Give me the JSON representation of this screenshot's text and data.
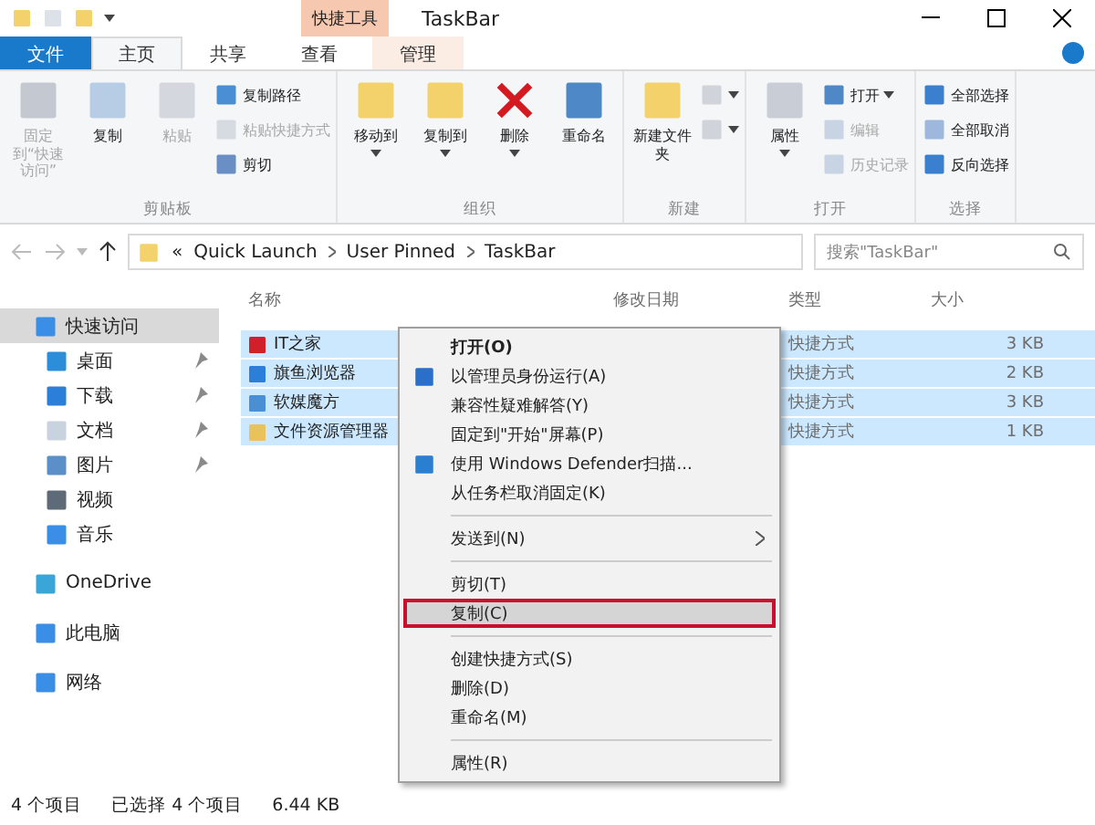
{
  "window": {
    "title": "TaskBar",
    "context_tab_group": "快捷工具"
  },
  "tabs": [
    {
      "label": "文件",
      "kind": "file",
      "selected": false
    },
    {
      "label": "主页",
      "kind": "tab",
      "selected": true
    },
    {
      "label": "共享",
      "kind": "tab",
      "selected": false
    },
    {
      "label": "查看",
      "kind": "tab",
      "selected": false
    },
    {
      "label": "管理",
      "kind": "context",
      "selected": false
    }
  ],
  "ribbon": {
    "groups": [
      {
        "label": "剪贴板",
        "items": [
          {
            "kind": "large",
            "label": "固定到“快速访问”",
            "disabled": true
          },
          {
            "kind": "large",
            "label": "复制",
            "disabled": false
          },
          {
            "kind": "large",
            "label": "粘贴",
            "disabled": true
          },
          {
            "kind": "stack",
            "items": [
              {
                "label": "复制路径",
                "disabled": false
              },
              {
                "label": "粘贴快捷方式",
                "disabled": true
              },
              {
                "label": "剪切",
                "disabled": false
              }
            ]
          }
        ]
      },
      {
        "label": "组织",
        "items": [
          {
            "kind": "large",
            "label": "移动到",
            "dropdown": true,
            "disabled": false
          },
          {
            "kind": "large",
            "label": "复制到",
            "dropdown": true,
            "disabled": false
          },
          {
            "kind": "large",
            "label": "删除",
            "dropdown": true,
            "disabled": false
          },
          {
            "kind": "large",
            "label": "重命名",
            "dropdown": false,
            "disabled": false
          }
        ]
      },
      {
        "label": "新建",
        "items": [
          {
            "kind": "large",
            "label": "新建文件夹",
            "dropdown": false,
            "disabled": false
          },
          {
            "kind": "stack",
            "items": [
              {
                "dropdown": true
              },
              {
                "dropdown": true
              }
            ]
          }
        ]
      },
      {
        "label": "打开",
        "items": [
          {
            "kind": "large",
            "label": "属性",
            "dropdown": true,
            "disabled": false
          },
          {
            "kind": "stack",
            "items": [
              {
                "label": "打开",
                "dropdown": true,
                "disabled": false
              },
              {
                "label": "编辑",
                "dropdown": false,
                "disabled": true
              },
              {
                "label": "历史记录",
                "dropdown": false,
                "disabled": true
              }
            ]
          }
        ]
      },
      {
        "label": "选择",
        "items": [
          {
            "kind": "stack",
            "items": [
              {
                "label": "全部选择",
                "disabled": false
              },
              {
                "label": "全部取消",
                "disabled": false
              },
              {
                "label": "反向选择",
                "disabled": false
              }
            ]
          }
        ]
      }
    ]
  },
  "address": {
    "overflow": "«",
    "path": [
      "Quick Launch",
      "User Pinned",
      "TaskBar"
    ]
  },
  "search": {
    "placeholder": "搜索\"TaskBar\""
  },
  "sidebar": {
    "items": [
      {
        "label": "快速访问",
        "selected": true,
        "children": [
          {
            "label": "桌面",
            "pinned": true,
            "selected": false
          },
          {
            "label": "下载",
            "pinned": true,
            "selected": false
          },
          {
            "label": "文档",
            "pinned": true,
            "selected": false
          },
          {
            "label": "图片",
            "pinned": true,
            "selected": false
          },
          {
            "label": "视频",
            "pinned": false,
            "selected": false
          },
          {
            "label": "音乐",
            "pinned": false,
            "selected": false
          }
        ]
      },
      {
        "label": "OneDrive",
        "selected": false
      },
      {
        "label": "此电脑",
        "selected": false
      },
      {
        "label": "网络",
        "selected": false
      }
    ]
  },
  "table": {
    "columns": [
      "名称",
      "修改日期",
      "类型",
      "大小"
    ],
    "rows": [
      {
        "name": "IT之家",
        "type": "快捷方式",
        "size": "3 KB",
        "selected": true
      },
      {
        "name": "旗鱼浏览器",
        "type": "快捷方式",
        "size": "2 KB",
        "selected": true
      },
      {
        "name": "软媒魔方",
        "type": "快捷方式",
        "size": "3 KB",
        "selected": true
      },
      {
        "name": "文件资源管理器",
        "type": "快捷方式",
        "size": "1 KB",
        "selected": true
      }
    ]
  },
  "context_menu": {
    "items": [
      {
        "kind": "item",
        "label": "打开(O)",
        "bold": true,
        "highlighted": false
      },
      {
        "kind": "item",
        "label": "以管理员身份运行(A)",
        "highlighted": false
      },
      {
        "kind": "item",
        "label": "兼容性疑难解答(Y)",
        "highlighted": false
      },
      {
        "kind": "item",
        "label": "固定到\"开始\"屏幕(P)",
        "highlighted": false
      },
      {
        "kind": "item",
        "label": "使用 Windows Defender扫描...",
        "highlighted": false
      },
      {
        "kind": "item",
        "label": "从任务栏取消固定(K)",
        "highlighted": false
      },
      {
        "kind": "separator"
      },
      {
        "kind": "submenu",
        "label": "发送到(N)",
        "highlighted": false
      },
      {
        "kind": "separator"
      },
      {
        "kind": "item",
        "label": "剪切(T)",
        "highlighted": false
      },
      {
        "kind": "item",
        "label": "复制(C)",
        "highlighted": true
      },
      {
        "kind": "separator"
      },
      {
        "kind": "item",
        "label": "创建快捷方式(S)",
        "highlighted": false
      },
      {
        "kind": "item",
        "label": "删除(D)",
        "highlighted": false
      },
      {
        "kind": "item",
        "label": "重命名(M)",
        "highlighted": false
      },
      {
        "kind": "separator"
      },
      {
        "kind": "item",
        "label": "属性(R)",
        "highlighted": false
      }
    ]
  },
  "status_bar": [
    "4 个项目",
    "已选择 4 个项目",
    "6.44 KB"
  ]
}
